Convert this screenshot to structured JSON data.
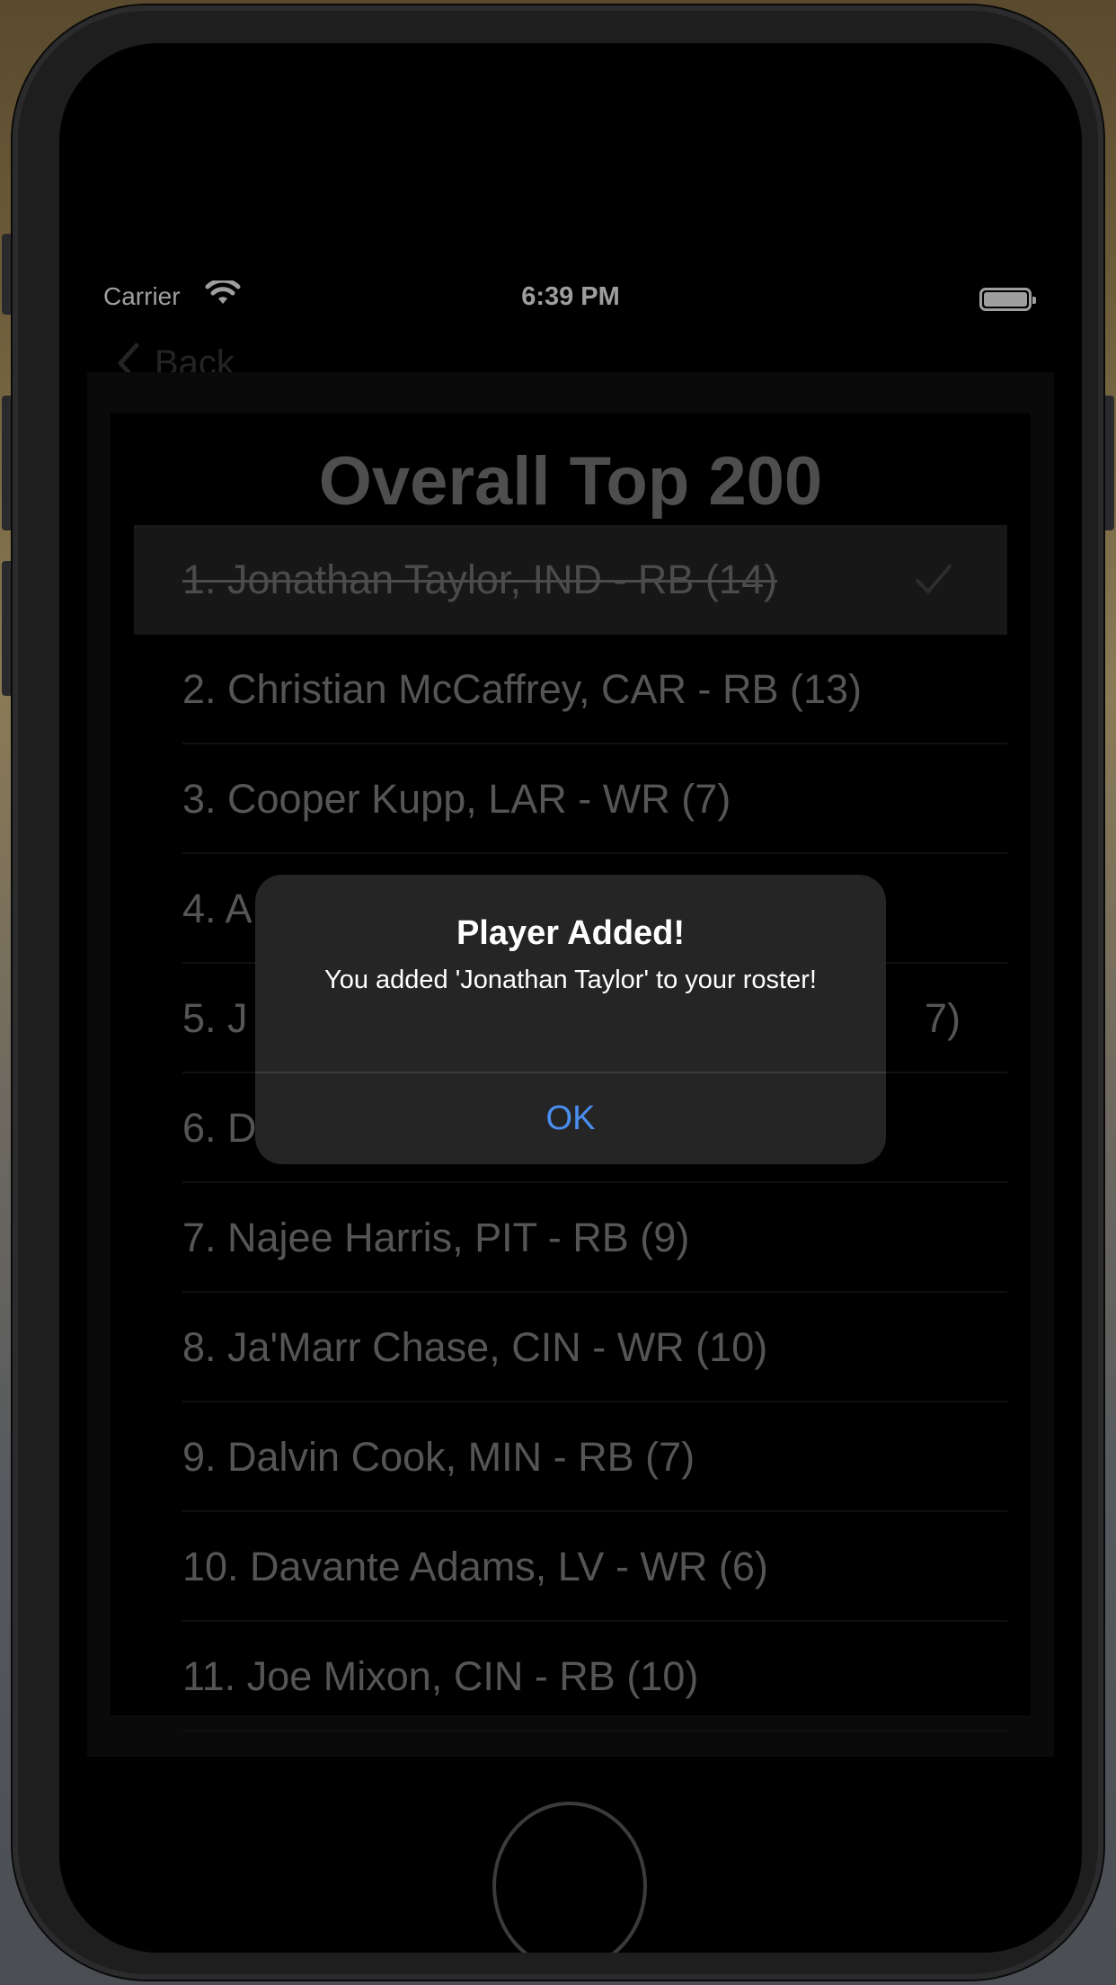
{
  "status_bar": {
    "carrier": "Carrier",
    "time": "6:39 PM"
  },
  "nav": {
    "back_label": "Back"
  },
  "list": {
    "title": "Overall Top 200",
    "rows": [
      {
        "text": "1.  Jonathan Taylor,  IND - RB (14)",
        "selected": true
      },
      {
        "text": "2.  Christian McCaffrey,  CAR - RB (13)"
      },
      {
        "text": "3.  Cooper Kupp,  LAR - WR (7)"
      },
      {
        "text": "4.  A"
      },
      {
        "text": "5.  J",
        "trailing": "7)"
      },
      {
        "text": "6.  D"
      },
      {
        "text": "7.  Najee Harris,  PIT - RB (9)"
      },
      {
        "text": "8.  Ja'Marr Chase,  CIN - WR (10)"
      },
      {
        "text": "9.  Dalvin Cook,  MIN - RB (7)"
      },
      {
        "text": "10.  Davante Adams,  LV - WR (6)"
      },
      {
        "text": "11.  Joe Mixon,  CIN - RB (10)"
      }
    ]
  },
  "alert": {
    "title": "Player Added!",
    "message": "You added 'Jonathan Taylor' to your roster!",
    "ok_label": "OK"
  },
  "icons": {
    "wifi": "wifi-icon",
    "battery": "battery-icon",
    "back": "chevron-left-icon",
    "check": "checkmark-icon"
  },
  "colors": {
    "alert_button": "#4a8ef0",
    "row_text": "#8a8a8a",
    "selected_row_bg": "#262626"
  }
}
